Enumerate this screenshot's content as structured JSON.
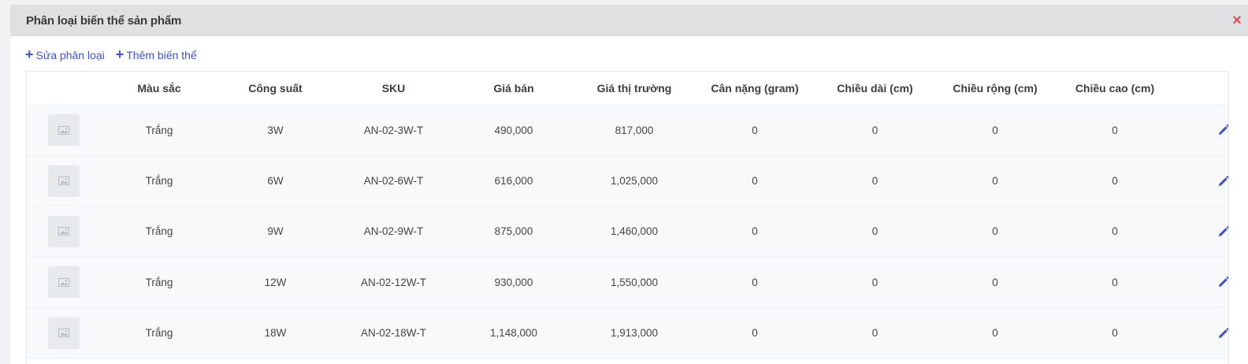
{
  "panel": {
    "title": "Phân loại biến thể sản phẩm",
    "close_label": "×"
  },
  "actions": {
    "edit_classification": "Sửa phân loại",
    "add_variant": "Thêm biến thể",
    "plus_glyph": "+"
  },
  "colors": {
    "accent": "#3f51d6",
    "danger": "#e35050",
    "header_bg": "#dfe0e2",
    "row_bg": "#f8f9fa"
  },
  "table": {
    "columns": [
      "",
      "Màu sắc",
      "Công suất",
      "SKU",
      "Giá bán",
      "Giá thị trường",
      "Cân nặng (gram)",
      "Chiều dài (cm)",
      "Chiều rộng (cm)",
      "Chiều cao (cm)",
      ""
    ],
    "rows": [
      {
        "color": "Trắng",
        "power": "3W",
        "sku": "AN-02-3W-T",
        "price": "490,000",
        "market_price": "817,000",
        "weight": "0",
        "length": "0",
        "width": "0",
        "height": "0"
      },
      {
        "color": "Trắng",
        "power": "6W",
        "sku": "AN-02-6W-T",
        "price": "616,000",
        "market_price": "1,025,000",
        "weight": "0",
        "length": "0",
        "width": "0",
        "height": "0"
      },
      {
        "color": "Trắng",
        "power": "9W",
        "sku": "AN-02-9W-T",
        "price": "875,000",
        "market_price": "1,460,000",
        "weight": "0",
        "length": "0",
        "width": "0",
        "height": "0"
      },
      {
        "color": "Trắng",
        "power": "12W",
        "sku": "AN-02-12W-T",
        "price": "930,000",
        "market_price": "1,550,000",
        "weight": "0",
        "length": "0",
        "width": "0",
        "height": "0"
      },
      {
        "color": "Trắng",
        "power": "18W",
        "sku": "AN-02-18W-T",
        "price": "1,148,000",
        "market_price": "1,913,000",
        "weight": "0",
        "length": "0",
        "width": "0",
        "height": "0"
      }
    ],
    "row_icons": {
      "thumbnail": "image-placeholder-icon",
      "edit": "pencil-icon",
      "delete": "trash-icon"
    }
  }
}
